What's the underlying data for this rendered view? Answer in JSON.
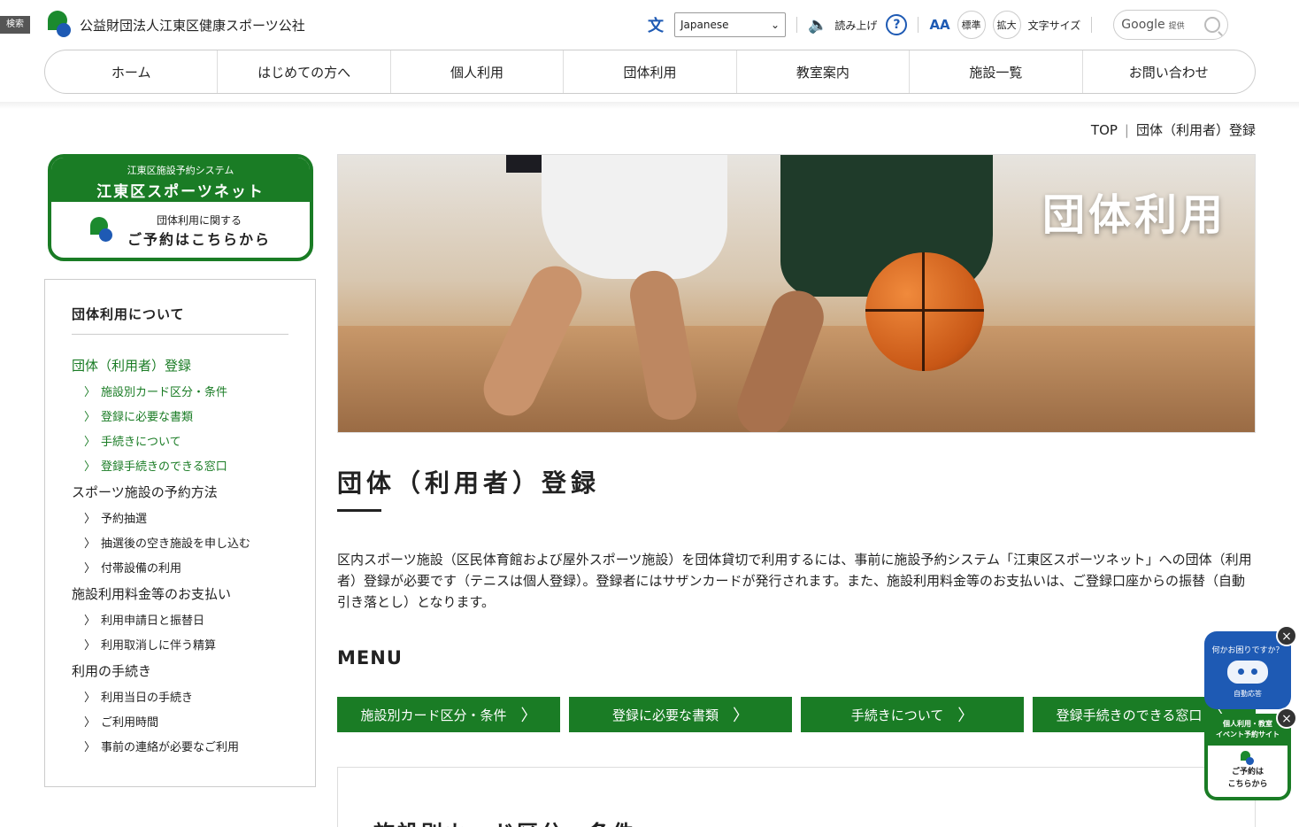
{
  "header": {
    "search_tag": "検索",
    "org_name": "公益財団法人江東区健康スポーツ公社",
    "language": "Japanese",
    "read_aloud": "読み上げ",
    "help": "?",
    "aa": "AA",
    "font_standard": "標準",
    "font_large": "拡大",
    "font_size_label": "文字サイズ",
    "google": "Google",
    "google_provided": "提供"
  },
  "nav": {
    "items": [
      "ホーム",
      "はじめての方へ",
      "個人利用",
      "団体利用",
      "教室案内",
      "施設一覧",
      "お問い合わせ"
    ]
  },
  "breadcrumb": {
    "top": "TOP",
    "divider": "|",
    "current": "団体（利用者）登録"
  },
  "reserve_banner": {
    "small": "江東区施設予約システム",
    "big": "江東区スポーツネット",
    "line1": "団体利用に関する",
    "line2": "ご予約はこちらから"
  },
  "side_menu": {
    "title": "団体利用について",
    "groups": [
      {
        "label": "団体（利用者）登録",
        "items": [
          "施設別カード区分・条件",
          "登録に必要な書類",
          "手続きについて",
          "登録手続きのできる窓口"
        ]
      },
      {
        "label": "スポーツ施設の予約方法",
        "items": [
          "予約抽選",
          "抽選後の空き施設を申し込む",
          "付帯設備の利用"
        ]
      },
      {
        "label": "施設利用料金等のお支払い",
        "items": [
          "利用申請日と振替日",
          "利用取消しに伴う精算"
        ]
      },
      {
        "label": "利用の手続き",
        "items": [
          "利用当日の手続き",
          "ご利用時間",
          "事前の連絡が必要なご利用"
        ]
      }
    ]
  },
  "hero": {
    "title": "団体利用"
  },
  "main": {
    "title": "団体（利用者）登録",
    "intro": "区内スポーツ施設（区民体育館および屋外スポーツ施設）を団体貸切で利用するには、事前に施設予約システム「江東区スポーツネット」への団体（利用者）登録が必要です（テニスは個人登録）。登録者にはサザンカードが発行されます。また、施設利用料金等のお支払いは、ご登録口座からの振替（自動引き落とし）となります。",
    "menu_heading": "MENU",
    "menu_buttons": [
      "施設別カード区分・条件",
      "登録に必要な書類",
      "手続きについて",
      "登録手続きのできる窓口"
    ],
    "section_title": "施設別カード区分・条件"
  },
  "widgets": {
    "chat_question": "何かお困りですか？",
    "chat_label": "自動応答",
    "reserve_top1": "個人利用・教室",
    "reserve_top2": "イベント予約サイト",
    "reserve_line1": "ご予約は",
    "reserve_line2": "こちらから",
    "close": "×"
  },
  "colors": {
    "brand_green": "#1a7c25",
    "brand_blue": "#1e5ab4"
  }
}
